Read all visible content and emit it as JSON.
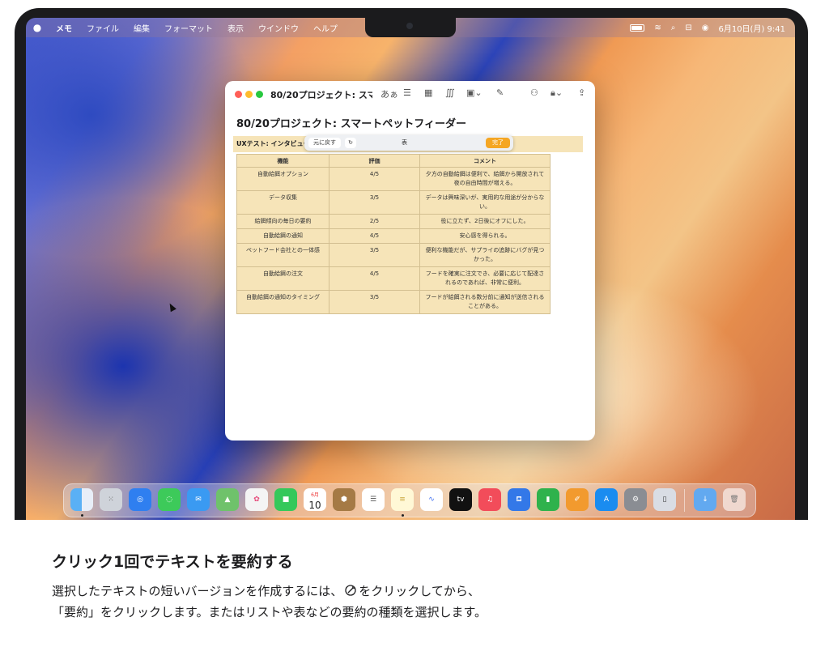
{
  "menubar": {
    "app_name": "メモ",
    "items": [
      "ファイル",
      "編集",
      "フォーマット",
      "表示",
      "ウインドウ",
      "ヘルプ"
    ],
    "clock": "6月10日(月)  9:41"
  },
  "window": {
    "title": "80/20プロジェクト: スマ...",
    "text_format_label": "あぁ",
    "note_title": "80/20プロジェクト: スマートペットフィーダー",
    "section_label": "UXテスト: インタビュー"
  },
  "writing_tools": {
    "undo_label": "元に戻す",
    "redo_icon": "redo-icon",
    "mode_label": "表",
    "done_label": "完了"
  },
  "table": {
    "headers": [
      "機能",
      "評価",
      "コメント"
    ],
    "rows": [
      [
        "自動給餌オプション",
        "4/5",
        "夕方の自動給餌は便利で、給餌から開放されて夜の自由時間が増える。"
      ],
      [
        "データ収集",
        "3/5",
        "データは興味深いが、実用的な用途が分からない。"
      ],
      [
        "給餌傾向の毎日の要約",
        "2/5",
        "役に立たず、2日後にオフにした。"
      ],
      [
        "自動給餌の通知",
        "4/5",
        "安心感を得られる。"
      ],
      [
        "ペットフード会社との一体感",
        "3/5",
        "便利な機能だが、サプライの追跡にバグが見つかった。"
      ],
      [
        "自動給餌の注文",
        "4/5",
        "フードを確実に注文でき、必要に応じて配達されるのであれば、非常に便利。"
      ],
      [
        "自動給餌の通知のタイミング",
        "3/5",
        "フードが給餌される数分前に通知が送信されることがある。"
      ]
    ]
  },
  "dock": {
    "calendar_month": "6月",
    "calendar_day": "10",
    "apps": [
      "finder",
      "launchpad",
      "safari",
      "messages",
      "mail",
      "maps",
      "photos",
      "facetime",
      "calendar",
      "keychain",
      "reminders",
      "notes",
      "freeform",
      "tv",
      "music",
      "keynote",
      "numbers",
      "pages",
      "app-store",
      "system-settings",
      "iphone-mirroring",
      "downloads",
      "trash"
    ]
  },
  "caption": {
    "title": "クリック1回でテキストを要約する",
    "line1_before": "選択したテキストの短いバージョンを作成するには、",
    "line1_after": "をクリックしてから、",
    "line2": "「要約」をクリックします。またはリストや表などの要約の種類を選択します。"
  },
  "colors": {
    "close": "#ff5f57",
    "minimize": "#febc2e",
    "zoom": "#28c840",
    "accent": "#f5a623",
    "table_bg": "#f6e4b8"
  }
}
